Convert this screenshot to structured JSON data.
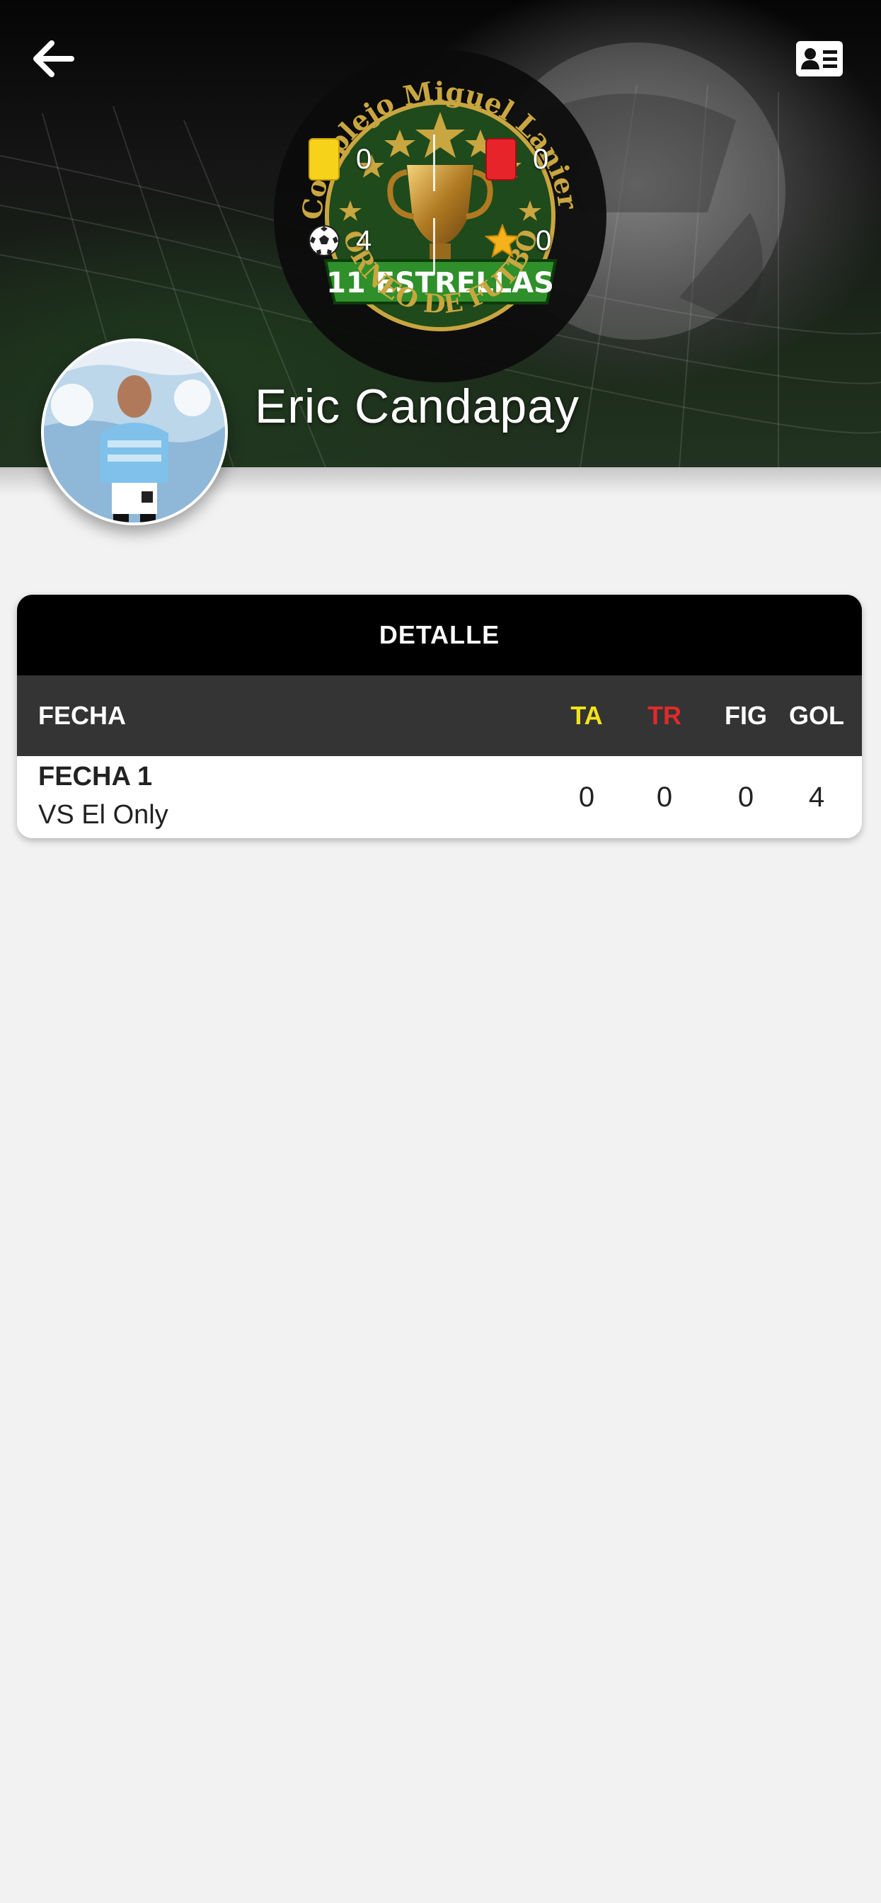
{
  "header": {
    "back_icon": "arrow-left-icon",
    "card_icon": "id-card-icon",
    "logo": {
      "ring_text": "Complejo Miguel Lanieri",
      "banner_text": "11 ESTRELLAS",
      "bottom_text": "TORNEO DE FUTBOL"
    },
    "stats": {
      "yellow_cards": "0",
      "red_cards": "0",
      "goals": "4",
      "mvp": "0"
    },
    "player_name": "Eric Candapay"
  },
  "detail": {
    "title": "DETALLE",
    "columns": {
      "fecha": "FECHA",
      "ta": "TA",
      "tr": "TR",
      "fig": "FIG",
      "gol": "GOL"
    },
    "rows": [
      {
        "fecha": "FECHA 1",
        "rival": "VS El Only",
        "ta": "0",
        "tr": "0",
        "fig": "0",
        "gol": "4"
      }
    ]
  },
  "colors": {
    "ta": "#f2e21c",
    "tr": "#e02a2a",
    "header_dark": "#343434",
    "title_bar": "#000000"
  }
}
